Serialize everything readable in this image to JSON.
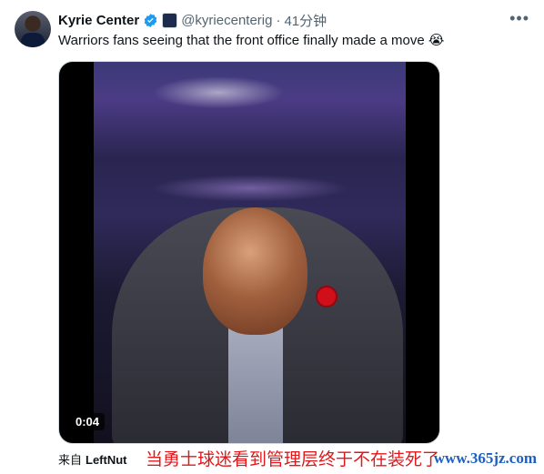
{
  "tweet": {
    "author_name": "Kyrie Center",
    "handle": "@kyriecenterig",
    "separator": "·",
    "time": "41分钟",
    "more_icon": "more-horizontal-icon",
    "verified_icon": "verified-badge-icon",
    "text": "Warriors fans seeing that the front office finally made a move 😭"
  },
  "video": {
    "duration": "0:04"
  },
  "footer": {
    "from_label": "来自",
    "source": "LeftNut"
  },
  "overlay": {
    "caption": "当勇士球迷看到管理层终于不在装死了",
    "watermark": "www.365jz.com"
  },
  "colors": {
    "verified_blue": "#1d9bf0",
    "caption_red": "#e0181b",
    "watermark_blue": "#1e5fbf"
  }
}
